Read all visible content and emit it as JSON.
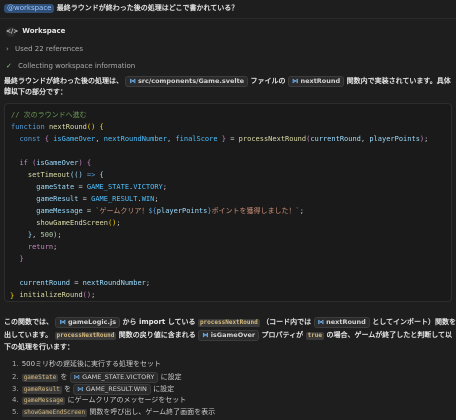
{
  "question": {
    "mention": "@workspace",
    "text": "最終ラウンドが終わった後の処理はどこで書かれている？"
  },
  "assistant": {
    "name": "Workspace"
  },
  "references": {
    "label": "Used 22 references"
  },
  "status": {
    "label": "Collecting workspace information"
  },
  "intro": {
    "p1": "最終ラウンドが終わった後の処理は、",
    "file": "src/components/Game.svelte",
    "p2": "ファイルの",
    "func": "nextRound",
    "p3": "関数内で実装されています。具体的に",
    "p4": "は以下の部分です："
  },
  "code": {
    "lines": [
      "// 次のラウンドへ進む",
      "function nextRound() {",
      "  const { isGameOver, nextRoundNumber, finalScore } = processNextRound(currentRound, playerPoints);",
      "",
      "  if (isGameOver) {",
      "    setTimeout(() => {",
      "      gameState = GAME_STATE.VICTORY;",
      "      gameResult = GAME_RESULT.WIN;",
      "      gameMessage = `ゲームクリア！${playerPoints}ポイントを獲得しました！`;",
      "      showGameEndScreen();",
      "    }, 500);",
      "    return;",
      "  }",
      "",
      "  currentRound = nextRoundNumber;",
      "  initializeRound();",
      "}"
    ]
  },
  "explain": {
    "a1": "この関数では、",
    "a2": "gameLogic.js",
    "a3": "から import している",
    "a4": "processNextRound",
    "a5": "（コード内では",
    "a6": "nextRound",
    "a7": "としてインポート）関数を呼び",
    "b1": "出しています。",
    "b2": "processNextRound",
    "b3": "関数の戻り値に含まれる",
    "b4": "isGameOver",
    "b5": "プロパティが",
    "b6": "true",
    "b7": "の場合、ゲームが終了したと判断して以",
    "c1": "下の処理を行います："
  },
  "list": [
    {
      "num": "1.",
      "parts": [
        {
          "t": "text",
          "v": "500ミリ秒の遅延後に実行する処理をセット"
        }
      ]
    },
    {
      "num": "2.",
      "parts": [
        {
          "t": "code",
          "v": "gameState"
        },
        {
          "t": "text",
          "v": " を "
        },
        {
          "t": "pill",
          "v": "GAME_STATE.VICTORY"
        },
        {
          "t": "text",
          "v": " に設定"
        }
      ]
    },
    {
      "num": "3.",
      "parts": [
        {
          "t": "code",
          "v": "gameResult"
        },
        {
          "t": "text",
          "v": " を "
        },
        {
          "t": "pill",
          "v": "GAME_RESULT.WIN"
        },
        {
          "t": "text",
          "v": " に設定"
        }
      ]
    },
    {
      "num": "4.",
      "parts": [
        {
          "t": "code",
          "v": "gameMessage"
        },
        {
          "t": "text",
          "v": " にゲームクリアのメッセージをセット"
        }
      ]
    },
    {
      "num": "5.",
      "parts": [
        {
          "t": "code",
          "v": "showGameEndScreen"
        },
        {
          "t": "text",
          "v": " 関数を呼び出し、ゲーム終了画面を表示"
        }
      ]
    }
  ]
}
